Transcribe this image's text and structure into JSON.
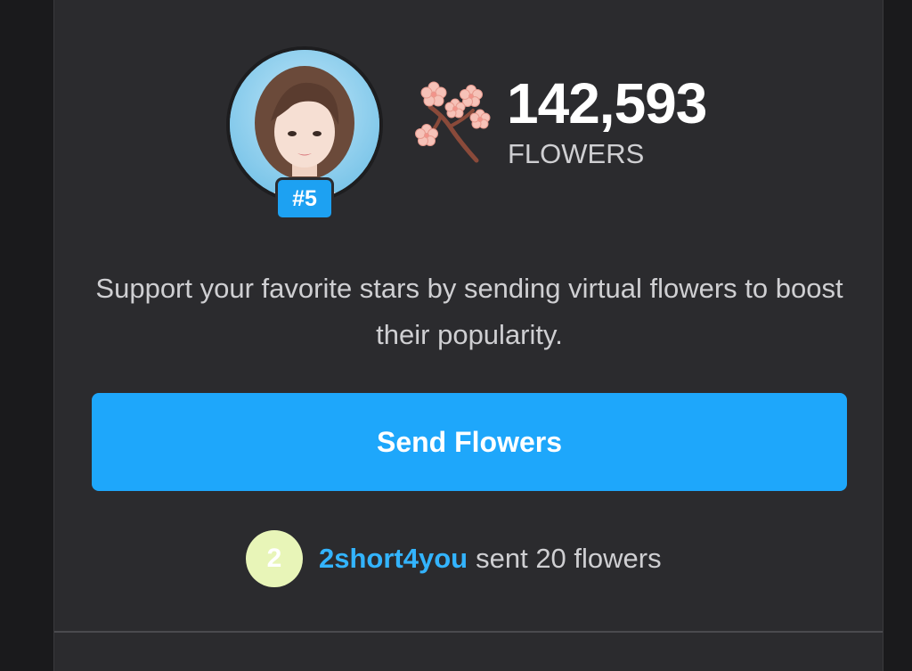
{
  "profile": {
    "rank": "#5",
    "avatar_icon": "user-photo"
  },
  "stats": {
    "flower_count": "142,593",
    "flower_label": "FLOWERS",
    "icon": "cherry-blossom-icon"
  },
  "description": "Support your favorite stars by sending virtual flowers to boost their popularity.",
  "send_button_label": "Send Flowers",
  "recent_activity": {
    "badge": "2",
    "user": "2short4you",
    "text": "sent 20 flowers"
  },
  "colors": {
    "accent": "#1ea7fb",
    "background": "#2b2b2e",
    "badge_bg": "#e8f5b8",
    "username": "#33b4ff"
  }
}
